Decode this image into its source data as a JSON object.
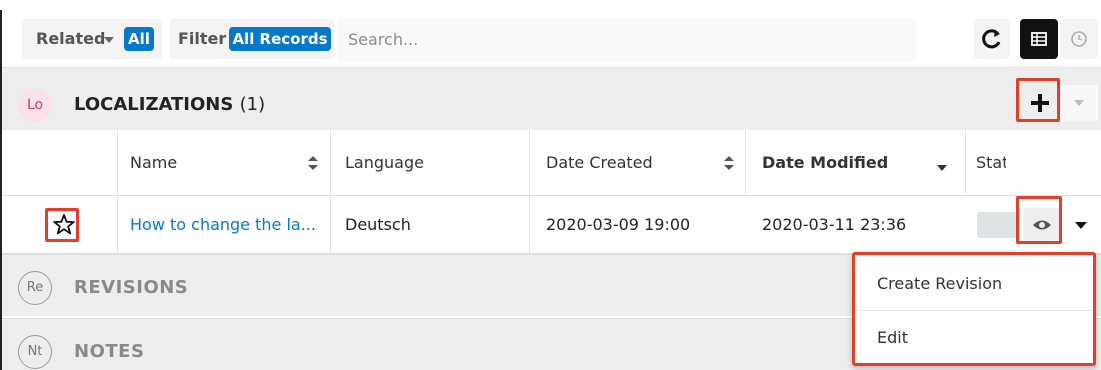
{
  "toolbar": {
    "related_label": "Related",
    "related_value": "All",
    "filter_label": "Filter",
    "filter_value": "All Records",
    "search_placeholder": "Search..."
  },
  "section": {
    "badge": "Lo",
    "title": "LOCALIZATIONS",
    "count": "(1)"
  },
  "table": {
    "columns": [
      "Name",
      "Language",
      "Date Created",
      "Date Modified",
      "Stat"
    ],
    "rows": [
      {
        "name": "How to change the la...",
        "language": "Deutsch",
        "date_created": "2020-03-09 19:00",
        "date_modified": "2020-03-11 23:36"
      }
    ]
  },
  "collapsed_sections": [
    {
      "badge": "Re",
      "title": "REVISIONS"
    },
    {
      "badge": "Nt",
      "title": "NOTES"
    }
  ],
  "row_menu": {
    "items": [
      "Create Revision",
      "Edit"
    ]
  },
  "colors": {
    "accent": "#0679c8",
    "highlight": "#e0402a",
    "header_bg": "#eeeeee"
  }
}
